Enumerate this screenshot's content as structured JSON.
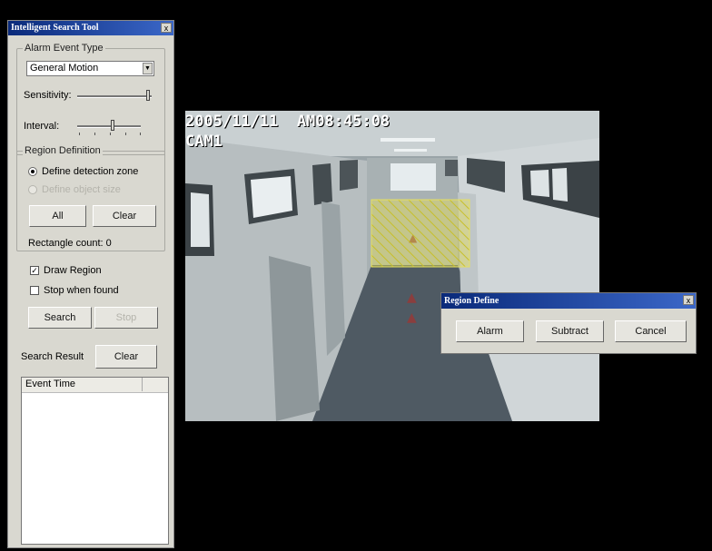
{
  "search_tool": {
    "title": "Intelligent Search Tool",
    "close_glyph": "x",
    "alarm_event_type": {
      "label": "Alarm Event Type",
      "selected": "General Motion",
      "sensitivity_label": "Sensitivity:",
      "sensitivity_level": 0.95,
      "interval_label": "Interval:",
      "interval_level": 0.55
    },
    "region_definition": {
      "label": "Region Definition",
      "option_define_zone": "Define detection zone",
      "option_object_size": "Define object size",
      "all_button": "All",
      "clear_button": "Clear",
      "rectangle_count": "Rectangle count: 0"
    },
    "draw_region_label": "Draw Region",
    "draw_region_checked": true,
    "stop_when_found_label": "Stop when found",
    "stop_when_found_checked": false,
    "search_button": "Search",
    "stop_button": "Stop",
    "search_result_label": "Search Result",
    "result_clear_button": "Clear",
    "list_header": "Event Time"
  },
  "video": {
    "timestamp": "2005/11/11  AM08:45:08",
    "camera": "CAM1"
  },
  "region_define_dialog": {
    "title": "Region Define",
    "close_glyph": "x",
    "alarm_button": "Alarm",
    "subtract_button": "Subtract",
    "cancel_button": "Cancel"
  }
}
